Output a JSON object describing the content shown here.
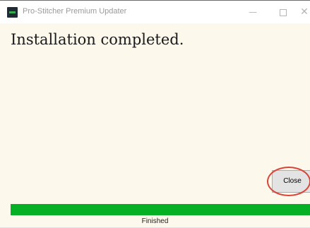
{
  "window": {
    "title": "Pro-Stitcher Premium Updater",
    "minimize_glyph": "—",
    "close_glyph": "✕"
  },
  "main": {
    "heading": "Installation completed."
  },
  "buttons": {
    "close_label": "Close"
  },
  "progress": {
    "fraction": 1.0,
    "status": "Finished"
  },
  "colors": {
    "background": "#fdf8ec",
    "progress_fill": "#06b025",
    "highlight_ring": "#d9453a"
  },
  "icons": {
    "app": "pro-stitcher-app-icon",
    "minimize": "minimize-icon",
    "maximize": "maximize-icon",
    "close": "close-icon"
  }
}
